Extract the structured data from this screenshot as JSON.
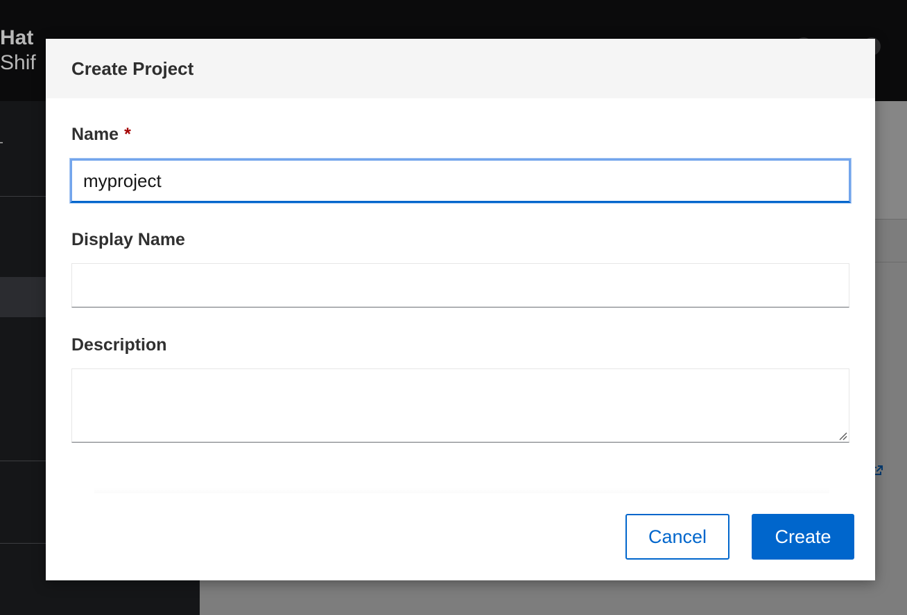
{
  "background": {
    "brand_line_1": "Hat",
    "brand_line_2": "Shif"
  },
  "modal": {
    "title": "Create Project",
    "fields": {
      "name": {
        "label": "Name",
        "required_mark": "*",
        "value": "myproject"
      },
      "display_name": {
        "label": "Display Name",
        "value": ""
      },
      "description": {
        "label": "Description",
        "value": ""
      }
    },
    "buttons": {
      "cancel": "Cancel",
      "create": "Create"
    }
  },
  "colors": {
    "primary": "#0066cc",
    "required": "#a30000",
    "header_bg": "#f5f5f5",
    "masthead_bg": "#0b0b0c"
  },
  "icons": {
    "external_link": "external-link-icon",
    "resize": "resize-grip-icon"
  }
}
